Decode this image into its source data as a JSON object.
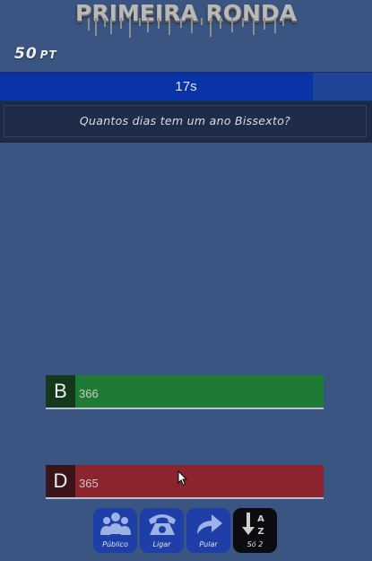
{
  "header": {
    "title": "PRIMEIRA RONDA"
  },
  "score": {
    "value": "50",
    "unit": "PT"
  },
  "timer": {
    "label": "17s",
    "fraction_remaining": 0.84
  },
  "question": {
    "text": "Quantos dias tem um ano Bissexto?"
  },
  "answers": [
    {
      "letter": "B",
      "text": "366",
      "color": "#1d7b33"
    },
    {
      "letter": "D",
      "text": "365",
      "color": "#8c2430"
    }
  ],
  "lifelines": [
    {
      "label": "Público",
      "icon": "audience-icon"
    },
    {
      "label": "Ligar",
      "icon": "phone-icon"
    },
    {
      "label": "Pular",
      "icon": "skip-arrow-icon"
    },
    {
      "label": "Só 2",
      "icon": "sort-az-icon"
    }
  ],
  "colors": {
    "background": "#3b5582",
    "timer_fill": "#0b33a8",
    "lifeline_bg": "#1e3ea8"
  }
}
